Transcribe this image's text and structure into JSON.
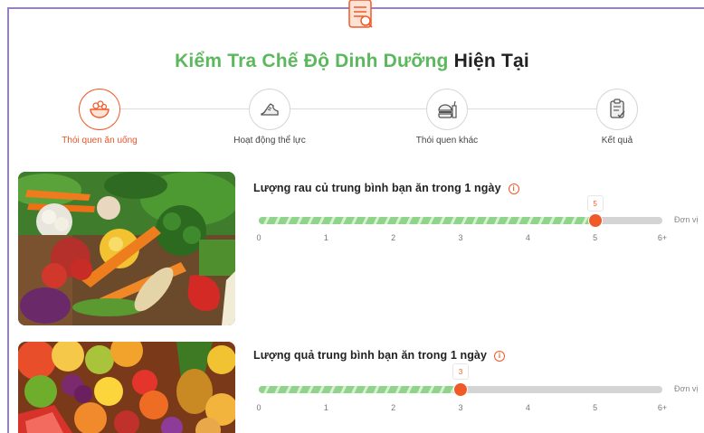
{
  "header": {
    "title_green": "Kiểm Tra Chế Độ Dinh Dưỡng",
    "title_dark": "Hiện Tại",
    "accent_color": "#5cb85c",
    "active_color": "#f05a28"
  },
  "steps": [
    {
      "label": "Thói quen ăn uống",
      "icon": "salad-bowl-icon",
      "active": true
    },
    {
      "label": "Hoạt động thể lực",
      "icon": "running-shoe-icon",
      "active": false
    },
    {
      "label": "Thói quen khác",
      "icon": "burger-drink-icon",
      "active": false
    },
    {
      "label": "Kết quả",
      "icon": "clipboard-check-icon",
      "active": false
    }
  ],
  "questions": [
    {
      "label": "Lượng rau củ trung bình bạn ăn trong 1 ngày",
      "image": "vegetables-photo",
      "value": 5,
      "value_text": "5",
      "min": 0,
      "max": 6,
      "ticks": [
        "0",
        "1",
        "2",
        "3",
        "4",
        "5",
        "6+"
      ],
      "unit_text": "Đơn vị"
    },
    {
      "label": "Lượng quả trung bình bạn ăn trong 1 ngày",
      "image": "fruits-photo",
      "value": 3,
      "value_text": "3",
      "min": 0,
      "max": 6,
      "ticks": [
        "0",
        "1",
        "2",
        "3",
        "4",
        "5",
        "6+"
      ],
      "unit_text": "Đơn vị"
    }
  ]
}
